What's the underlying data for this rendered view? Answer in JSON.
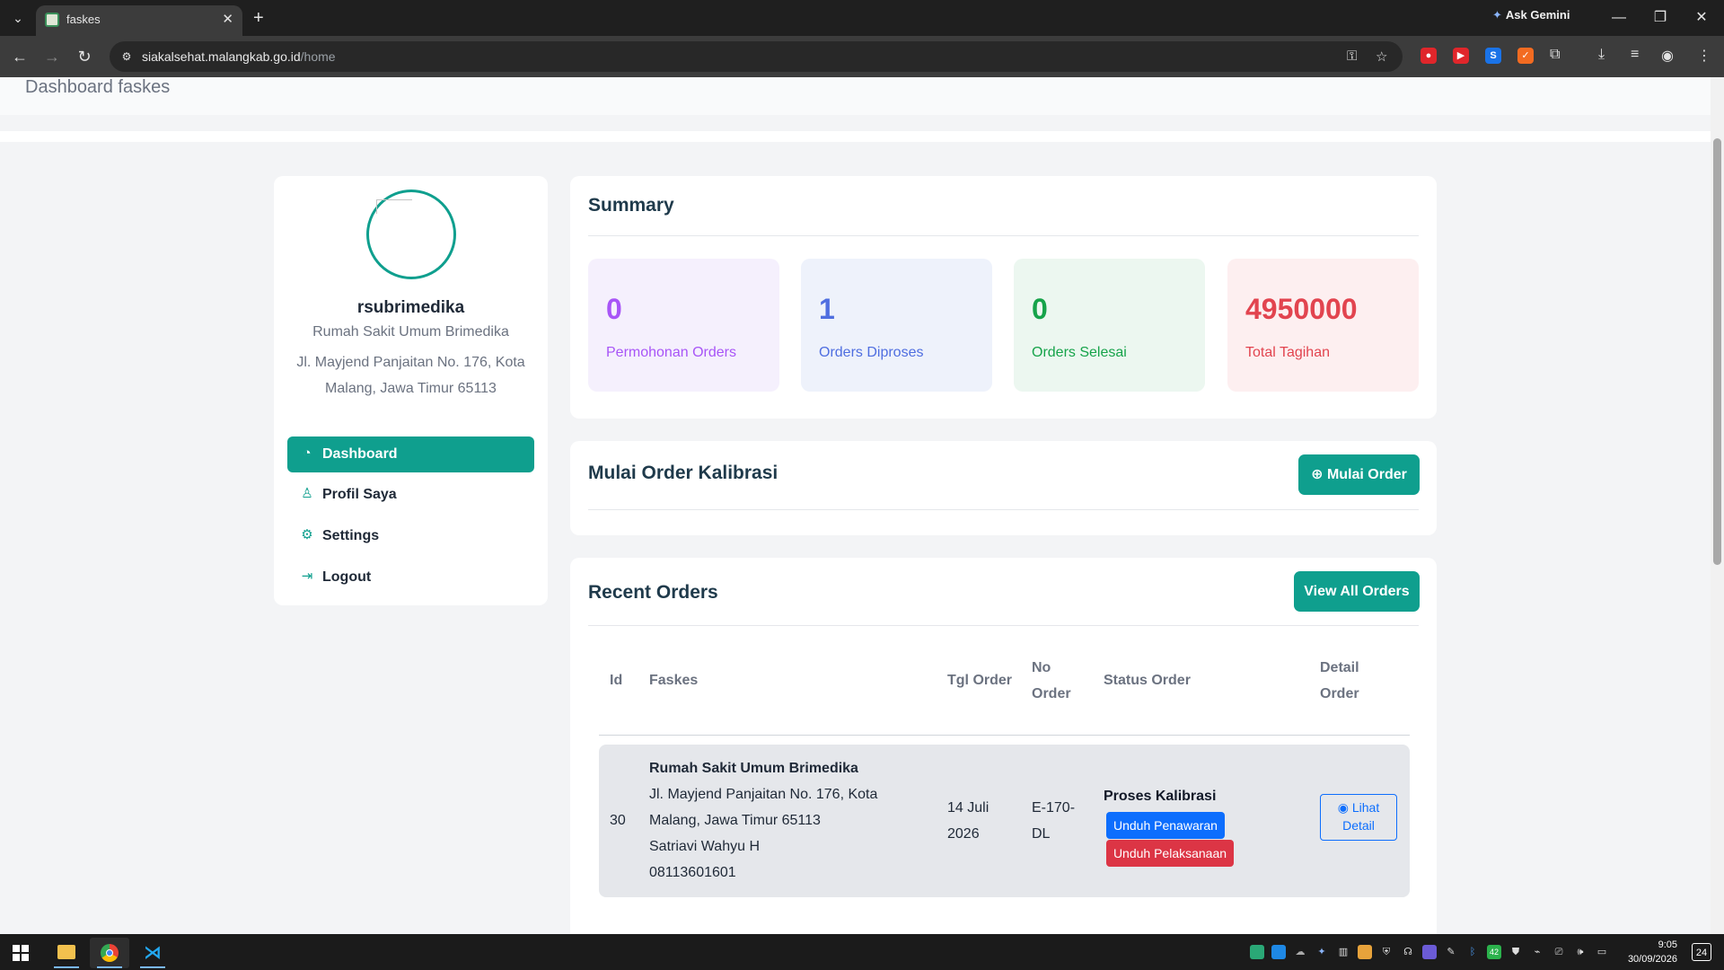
{
  "browser": {
    "tab_title": "faskes",
    "url_host": "siakalsehat.malangkab.go.id",
    "url_path": "/home",
    "ask_gemini": "Ask Gemini"
  },
  "page": {
    "title": "Dashboard faskes"
  },
  "profile": {
    "username": "rsubrimedika",
    "facility_name": "Rumah Sakit Umum Brimedika",
    "address": "Jl. Mayjend Panjaitan No. 176, Kota Malang, Jawa Timur 65113"
  },
  "menu": [
    {
      "label": "Dashboard",
      "icon": "dashboard-icon",
      "active": true
    },
    {
      "label": "Profil Saya",
      "icon": "user-icon",
      "active": false
    },
    {
      "label": "Settings",
      "icon": "gear-icon",
      "active": false
    },
    {
      "label": "Logout",
      "icon": "logout-icon",
      "active": false
    }
  ],
  "summary": {
    "title": "Summary",
    "stats": [
      {
        "value": "0",
        "label": "Permohonan Orders",
        "color": "#a855f7",
        "bg": "#f5f0fd"
      },
      {
        "value": "1",
        "label": "Orders Diproses",
        "color": "#4f6ee0",
        "bg": "#eef2fb"
      },
      {
        "value": "0",
        "label": "Orders Selesai",
        "color": "#16a34a",
        "bg": "#ecf7f0"
      },
      {
        "value": "4950000",
        "label": "Total Tagihan",
        "color": "#e2444f",
        "bg": "#fdeff0"
      }
    ]
  },
  "start_order": {
    "title": "Mulai Order Kalibrasi",
    "button": "Mulai Order"
  },
  "recent_orders": {
    "title": "Recent Orders",
    "view_all": "View All Orders",
    "headers": {
      "id": "Id",
      "faskes": "Faskes",
      "tgl_order_1": "Tgl Order",
      "no_order_1": "No",
      "no_order_2": "Order",
      "status": "Status Order",
      "detail_1": "Detail",
      "detail_2": "Order"
    },
    "rows": [
      {
        "id": "30",
        "faskes_name": "Rumah Sakit Umum Brimedika",
        "faskes_addr_1": "Jl. Mayjend Panjaitan No. 176, Kota",
        "faskes_addr_2": "Malang, Jawa Timur 65113",
        "contact_name": "Satriavi Wahyu H",
        "contact_phone": "08113601601",
        "tgl_1": "14 Juli",
        "tgl_2": "2026",
        "no_1": "E-170-",
        "no_2": "DL",
        "status": "Proses Kalibrasi",
        "btn_penawaran": "Unduh Penawaran",
        "btn_pelaksanaan": "Unduh Pelaksanaan",
        "detail_1": "Lihat",
        "detail_2": "Detail"
      }
    ]
  },
  "colors": {
    "teal": "#0f9f8e",
    "blue": "#0d6efd",
    "red": "#dc3545"
  },
  "taskbar": {
    "time": "9:05",
    "date": "30/09/2026",
    "notifications": "24"
  }
}
